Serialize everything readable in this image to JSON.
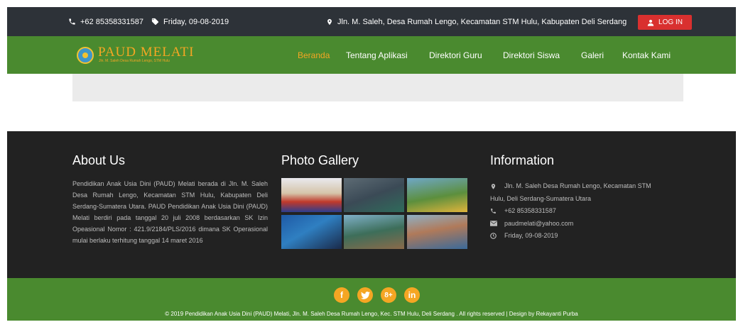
{
  "topbar": {
    "phone": "+62 85358331587",
    "date": "Friday, 09-08-2019",
    "address": "Jln. M. Saleh, Desa Rumah Lengo, Kecamatan STM Hulu, Kabupaten Deli Serdang",
    "login_label": "LOG IN"
  },
  "brand": {
    "title": "PAUD MELATI",
    "subtitle": "Jln. M. Saleh Desa Rumah Lengo, STM Hulu"
  },
  "nav": {
    "items": [
      {
        "label": "Beranda",
        "active": true
      },
      {
        "label": "Tentang Aplikasi",
        "active": false
      },
      {
        "label": "Direktori Guru",
        "active": false
      },
      {
        "label": "Direktori Siswa",
        "active": false
      },
      {
        "label": "Galeri",
        "active": false
      },
      {
        "label": "Kontak Kami",
        "active": false
      }
    ]
  },
  "footer": {
    "about": {
      "title": "About Us",
      "text": "Pendidikan Anak Usia Dini (PAUD) Melati berada di Jln. M. Saleh Desa Rumah Lengo, Kecamatan STM Hulu, Kabupaten Deli Serdang-Sumatera Utara. PAUD Pendidikan Anak Usia Dini (PAUD) Melati berdiri pada tanggal 20 juli 2008 berdasarkan SK Izin Opeasional Nomor : 421.9/2184/PLS/2016 dimana SK Operasional mulai berlaku terhitung tanggal 14 maret 2016"
    },
    "gallery": {
      "title": "Photo Gallery"
    },
    "info": {
      "title": "Information",
      "address_line1": "Jln. M. Saleh Desa Rumah Lengo, Kecamatan STM",
      "address_line2": "Hulu, Deli Serdang-Sumatera Utara",
      "phone": "+62 85358331587",
      "email": "paudmelati@yahoo.com",
      "date": "Friday, 09-08-2019"
    }
  },
  "social": {
    "facebook": "f",
    "googleplus": "8+",
    "linkedin": "in"
  },
  "copyright": "© 2019 Pendidikan Anak Usia Dini (PAUD) Melati, Jln. M. Saleh Desa Rumah Lengo, Kec. STM Hulu, Deli Serdang . All rights reserved | Design by Rekayanti Purba",
  "colors": {
    "topbar": "#2d3238",
    "brand_green": "#4a8a2f",
    "accent_orange": "#f5a623",
    "login_red": "#d9302f",
    "footer_dark": "#222222"
  }
}
